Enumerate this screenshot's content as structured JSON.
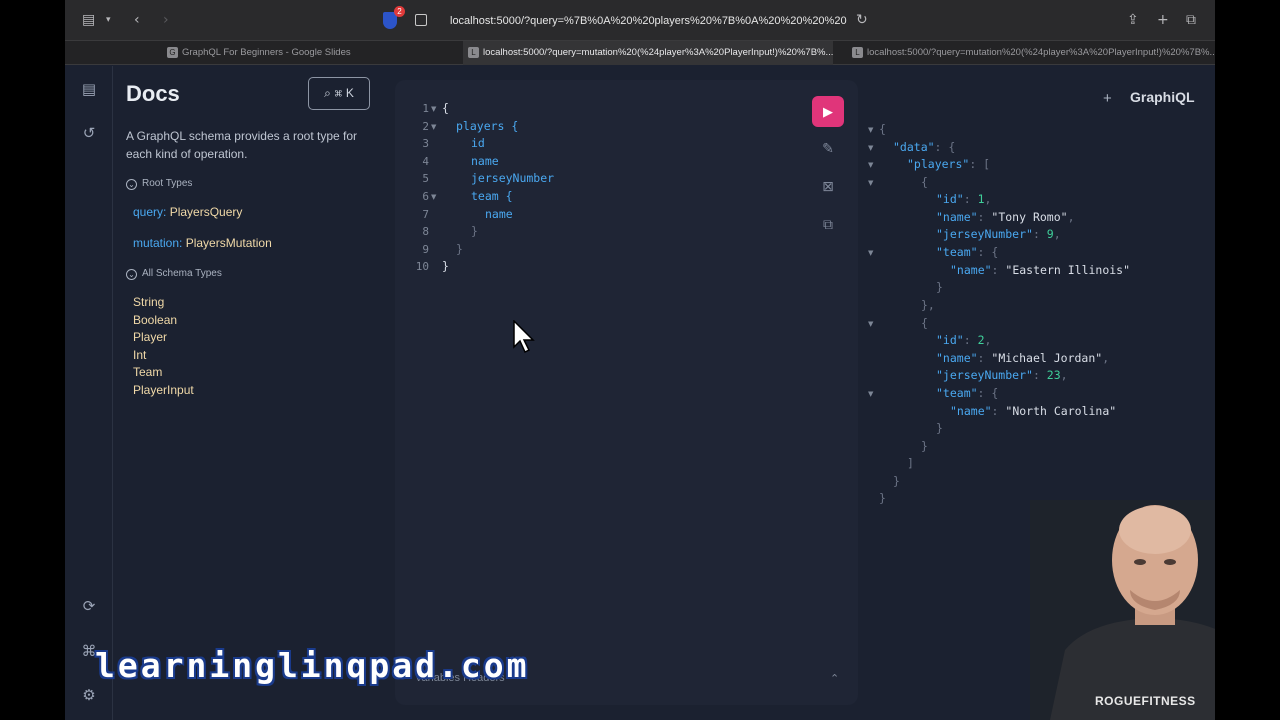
{
  "browser": {
    "url": "localhost:5000/?query=%7B%0A%20%20players%20%7B%0A%20%20%20%20",
    "badge_count": "2",
    "tabs": [
      {
        "favicon": "G",
        "label": "GraphQL For Beginners - Google Slides"
      },
      {
        "favicon": "L",
        "label": "localhost:5000/?query=mutation%20(%24player%3A%20PlayerInput!)%20%7B%..."
      },
      {
        "favicon": "L",
        "label": "localhost:5000/?query=mutation%20(%24player%3A%20PlayerInput!)%20%7B%..."
      }
    ]
  },
  "docs": {
    "title": "Docs",
    "search_label": "⌘ K",
    "description": "A GraphQL schema provides a root type for each kind of operation.",
    "root_types_heading": "Root Types",
    "root_types": [
      {
        "key": "query",
        "value": "PlayersQuery"
      },
      {
        "key": "mutation",
        "value": "PlayersMutation"
      }
    ],
    "all_types_heading": "All Schema Types",
    "types": [
      "String",
      "Boolean",
      "Player",
      "Int",
      "Team",
      "PlayerInput"
    ]
  },
  "editor": {
    "line_numbers": [
      "1",
      "2",
      "3",
      "4",
      "5",
      "6",
      "7",
      "8",
      "9",
      "10"
    ],
    "lines": [
      {
        "text": "{",
        "style": "plain"
      },
      {
        "text": "players",
        "style": "field",
        "suffix": " {"
      },
      {
        "text": "id",
        "style": "field"
      },
      {
        "text": "name",
        "style": "field"
      },
      {
        "text": "jerseyNumber",
        "style": "field"
      },
      {
        "text": "team",
        "style": "field",
        "suffix": " {"
      },
      {
        "text": "name",
        "style": "field"
      },
      {
        "text": "}",
        "style": "brace"
      },
      {
        "text": "}",
        "style": "brace"
      },
      {
        "text": "}",
        "style": "plain"
      }
    ],
    "bottom_tabs": "Variables   Headers"
  },
  "result": {
    "brand": "GraphiQL",
    "players": [
      {
        "id": "1",
        "name": "\"Tony Romo\"",
        "jerseyNumber": "9",
        "team_name": "\"Eastern Illinois\""
      },
      {
        "id": "2",
        "name": "\"Michael Jordan\"",
        "jerseyNumber": "23",
        "team_name": "\"North Carolina\""
      }
    ]
  },
  "overlay": {
    "watermark": "learninglinqpad.com",
    "shirt_logo": "ROGUEFITNESS"
  }
}
